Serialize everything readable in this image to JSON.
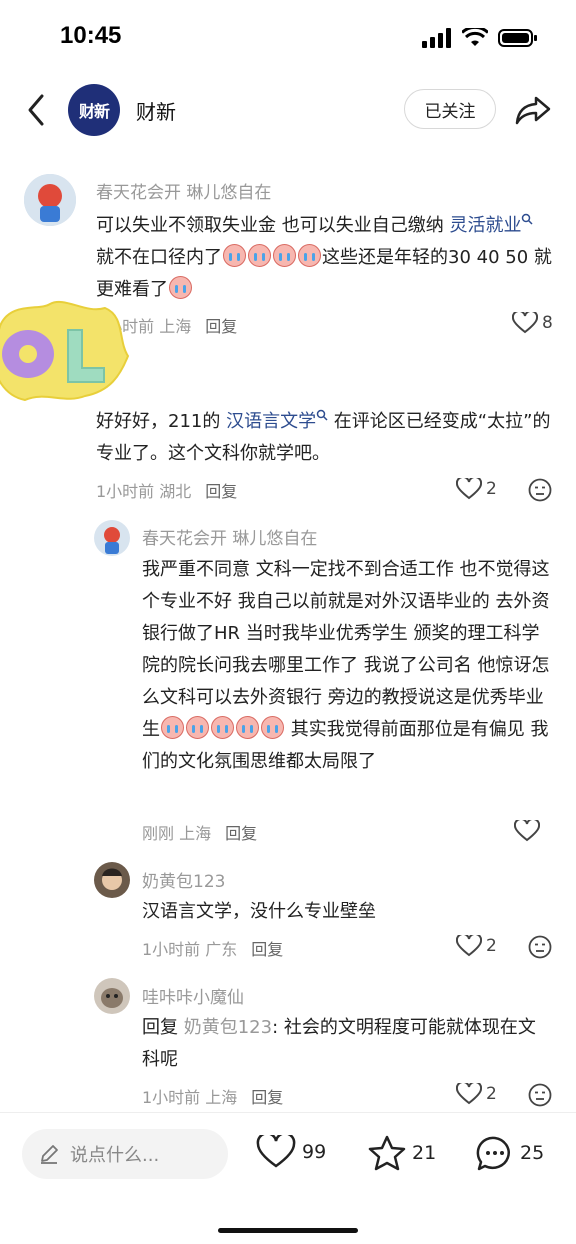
{
  "status": {
    "time": "10:45"
  },
  "nav": {
    "logo_text": "财新",
    "title": "财新",
    "follow_label": "已关注"
  },
  "comments": [
    {
      "name": "春天花会开 琳儿悠自在",
      "text_a": "可以失业不领取失业金 也可以失业自己缴纳 ",
      "link": "灵活就业",
      "text_b": " 就不在口径内了",
      "text_c": "这些还是年轻的30 40 50 就更难看了",
      "time_loc": "0小时前 上海",
      "reply_label": "回复",
      "likes": "8"
    },
    {
      "text_a": "好好好，211的 ",
      "link": "汉语言文学",
      "text_b": " 在评论区已经变成“太拉”的专业了。这个文科你就学吧。",
      "time_loc": "1小时前 湖北",
      "reply_label": "回复",
      "likes": "2"
    }
  ],
  "replies": [
    {
      "name": "春天花会开 琳儿悠自在",
      "text_a": "我严重不同意 文科一定找不到合适工作 也不觉得这个专业不好 我自己以前就是对外汉语毕业的 去外资银行做了HR 当时我毕业优秀学生 颁奖的理工科学院的院长问我去哪里工作了 我说了公司名  他惊讶怎么文科可以去外资银行 旁边的教授说这是优秀毕业生",
      "text_b": " 其实我觉得前面那位是有偏见 我们的文化氛围思维都太局限了",
      "time_loc": "刚刚 上海",
      "reply_label": "回复"
    },
    {
      "name": "奶黄包123",
      "text": "汉语言文学，没什么专业壁垒",
      "time_loc": "1小时前 广东",
      "reply_label": "回复",
      "likes": "2"
    },
    {
      "name": "哇咔咔小魔仙",
      "reply_prefix": "回复 ",
      "reply_to": "奶黄包123",
      "text": ": 社会的文明程度可能就体现在文科呢",
      "time_loc": "1小时前 上海",
      "reply_label": "回复",
      "likes": "2"
    }
  ],
  "bottom": {
    "input_placeholder": "说点什么...",
    "like_count": "99",
    "fav_count": "21",
    "comment_count": "25"
  },
  "sticker_text": "OL"
}
